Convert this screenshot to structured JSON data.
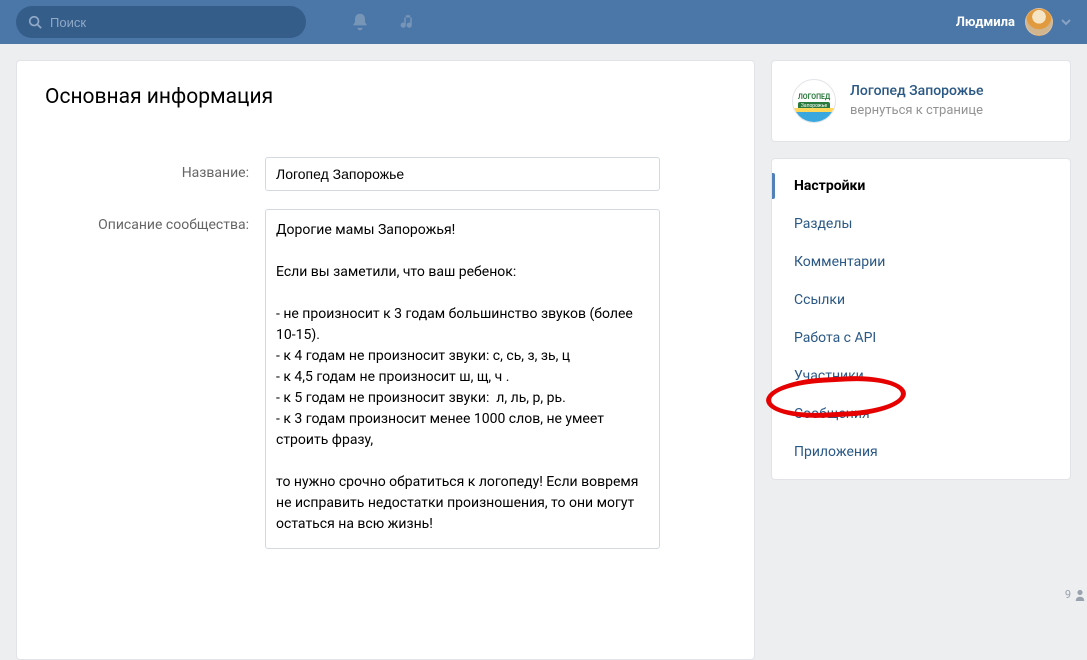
{
  "header": {
    "search_placeholder": "Поиск",
    "username": "Людмила"
  },
  "main": {
    "title": "Основная информация",
    "name_label": "Название:",
    "name_value": "Логопед Запорожье",
    "desc_label": "Описание сообщества:",
    "desc_value": "Дорогие мамы Запорожья!\n\nЕсли вы заметили, что ваш ребенок:\n\n- не произносит к 3 годам большинство звуков (более 10-15).\n- к 4 годам не произносит звуки: с, сь, з, зь, ц\n- к 4,5 годам не произносит ш, щ, ч .\n- к 5 годам не произносит звуки:  л, ль, р, рь.\n- к 3 годам произносит менее 1000 слов, не умеет строить фразу,\n\nто нужно срочно обратиться к логопеду! Если вовремя не исправить недостатки произношения, то они могут остаться на всю жизнь!"
  },
  "sidebar": {
    "group_name": "Логопед Запорожье",
    "back_text": "вернуться к странице",
    "logo_top": "ЛОГОПЕД",
    "logo_ribbon": "Запорожье",
    "items": [
      {
        "label": "Настройки",
        "active": true
      },
      {
        "label": "Разделы",
        "active": false
      },
      {
        "label": "Комментарии",
        "active": false
      },
      {
        "label": "Ссылки",
        "active": false
      },
      {
        "label": "Работа с API",
        "active": false
      },
      {
        "label": "Участники",
        "active": false
      },
      {
        "label": "Сообщения",
        "active": false
      },
      {
        "label": "Приложения",
        "active": false
      }
    ]
  },
  "widget_count": "9"
}
